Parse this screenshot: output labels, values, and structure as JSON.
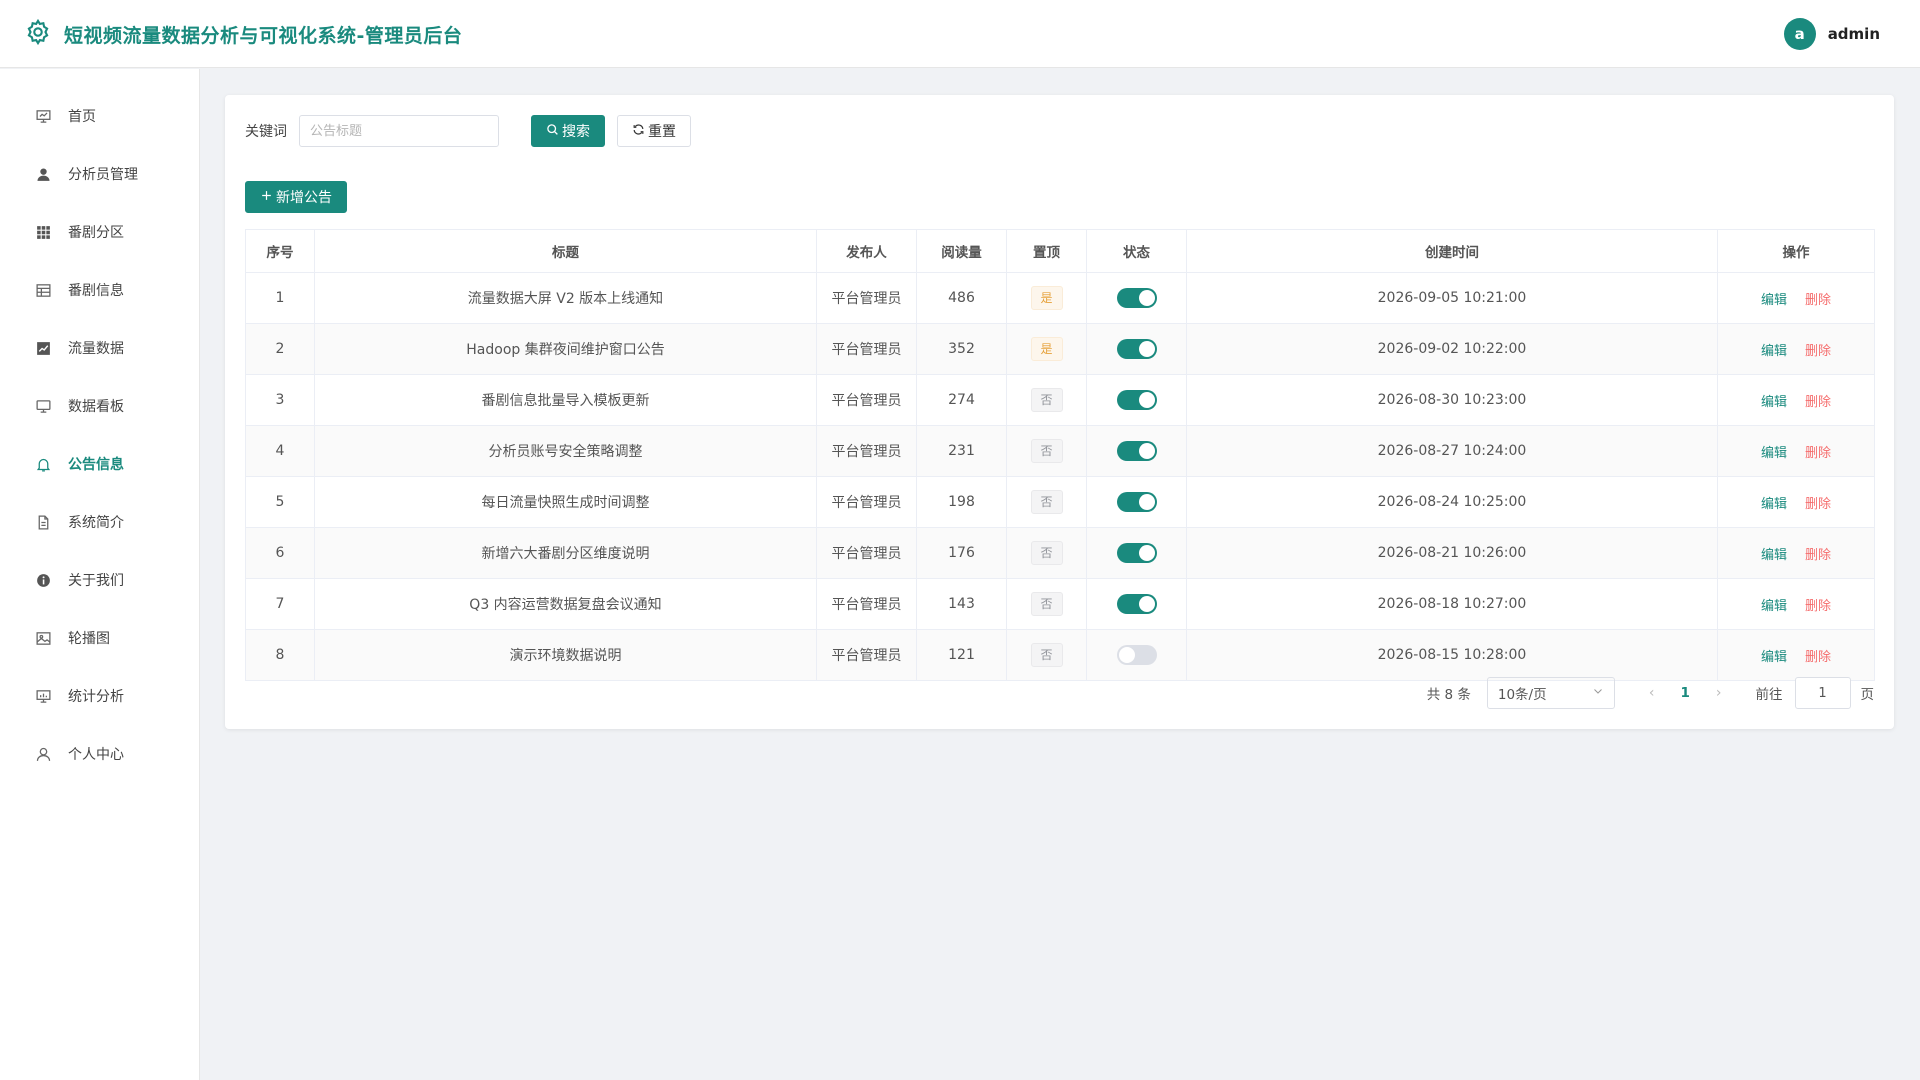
{
  "header": {
    "title": "短视频流量数据分析与可视化系统-管理员后台",
    "avatar_letter": "a",
    "username": "admin"
  },
  "sidebar": {
    "items": [
      {
        "label": "首页",
        "icon": "presentation-icon"
      },
      {
        "label": "分析员管理",
        "icon": "user-icon"
      },
      {
        "label": "番剧分区",
        "icon": "grid-icon"
      },
      {
        "label": "番剧信息",
        "icon": "table-icon"
      },
      {
        "label": "流量数据",
        "icon": "trend-chart-icon"
      },
      {
        "label": "数据看板",
        "icon": "monitor-icon"
      },
      {
        "label": "公告信息",
        "icon": "bell-icon",
        "active": true
      },
      {
        "label": "系统简介",
        "icon": "document-icon"
      },
      {
        "label": "关于我们",
        "icon": "info-icon"
      },
      {
        "label": "轮播图",
        "icon": "picture-icon"
      },
      {
        "label": "统计分析",
        "icon": "data-board-icon"
      },
      {
        "label": "个人中心",
        "icon": "user-outline-icon"
      }
    ]
  },
  "search": {
    "keyword_label": "关键词",
    "placeholder": "公告标题",
    "search_label": "搜索",
    "reset_label": "重置"
  },
  "add_button_label": "新增公告",
  "table": {
    "columns": [
      "序号",
      "标题",
      "发布人",
      "阅读量",
      "置顶",
      "状态",
      "创建时间",
      "操作"
    ],
    "edit_label": "编辑",
    "delete_label": "删除",
    "rows": [
      {
        "index": "1",
        "title": "流量数据大屏 V2 版本上线通知",
        "publisher": "平台管理员",
        "reads": "486",
        "pinned": "是",
        "pinned_bool": true,
        "status_on": true,
        "created": "2026-09-05 10:21:00"
      },
      {
        "index": "2",
        "title": "Hadoop 集群夜间维护窗口公告",
        "publisher": "平台管理员",
        "reads": "352",
        "pinned": "是",
        "pinned_bool": true,
        "status_on": true,
        "created": "2026-09-02 10:22:00"
      },
      {
        "index": "3",
        "title": "番剧信息批量导入模板更新",
        "publisher": "平台管理员",
        "reads": "274",
        "pinned": "否",
        "pinned_bool": false,
        "status_on": true,
        "created": "2026-08-30 10:23:00"
      },
      {
        "index": "4",
        "title": "分析员账号安全策略调整",
        "publisher": "平台管理员",
        "reads": "231",
        "pinned": "否",
        "pinned_bool": false,
        "status_on": true,
        "created": "2026-08-27 10:24:00"
      },
      {
        "index": "5",
        "title": "每日流量快照生成时间调整",
        "publisher": "平台管理员",
        "reads": "198",
        "pinned": "否",
        "pinned_bool": false,
        "status_on": true,
        "created": "2026-08-24 10:25:00"
      },
      {
        "index": "6",
        "title": "新增六大番剧分区维度说明",
        "publisher": "平台管理员",
        "reads": "176",
        "pinned": "否",
        "pinned_bool": false,
        "status_on": true,
        "created": "2026-08-21 10:26:00"
      },
      {
        "index": "7",
        "title": "Q3 内容运营数据复盘会议通知",
        "publisher": "平台管理员",
        "reads": "143",
        "pinned": "否",
        "pinned_bool": false,
        "status_on": true,
        "created": "2026-08-18 10:27:00"
      },
      {
        "index": "8",
        "title": "演示环境数据说明",
        "publisher": "平台管理员",
        "reads": "121",
        "pinned": "否",
        "pinned_bool": false,
        "status_on": false,
        "created": "2026-08-15 10:28:00"
      }
    ]
  },
  "pagination": {
    "total_text": "共 8 条",
    "page_size": "10条/页",
    "current_page": "1",
    "goto_label": "前往",
    "goto_value": "1",
    "page_unit": "页"
  },
  "colors": {
    "primary": "#1a8a7e",
    "danger": "#f56c6c",
    "warning": "#e6a23c"
  }
}
